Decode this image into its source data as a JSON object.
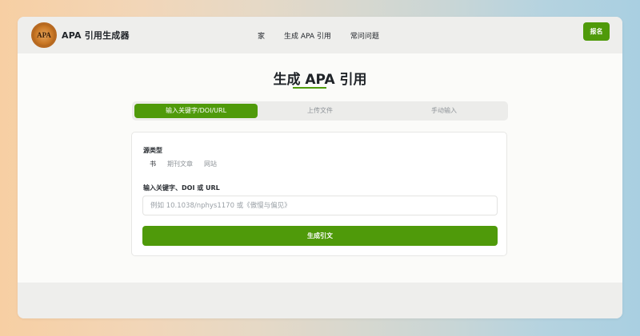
{
  "header": {
    "logo_text": "APA",
    "brand_name": "APA 引用生成器",
    "nav": [
      {
        "label": "家"
      },
      {
        "label": "生成 APA 引用"
      },
      {
        "label": "常问问题"
      }
    ],
    "signup_label": "报名"
  },
  "main": {
    "title": "生成 APA 引用",
    "tabs": [
      {
        "label": "输入关键字/DOI/URL",
        "active": true
      },
      {
        "label": "上传文件",
        "active": false
      },
      {
        "label": "手动输入",
        "active": false
      }
    ],
    "form": {
      "source_type_label": "源类型",
      "source_types": [
        {
          "label": "书",
          "selected": true
        },
        {
          "label": "期刊文章",
          "selected": false
        },
        {
          "label": "网站",
          "selected": false
        }
      ],
      "search_label": "输入关键字、DOI 或 URL",
      "search_placeholder": "例如 10.1038/nphys1170 或《傲慢与偏见》",
      "search_value": "",
      "generate_label": "生成引文"
    }
  },
  "colors": {
    "accent": "#4f9a0a",
    "text": "#1f2328",
    "muted": "#8f9499"
  }
}
